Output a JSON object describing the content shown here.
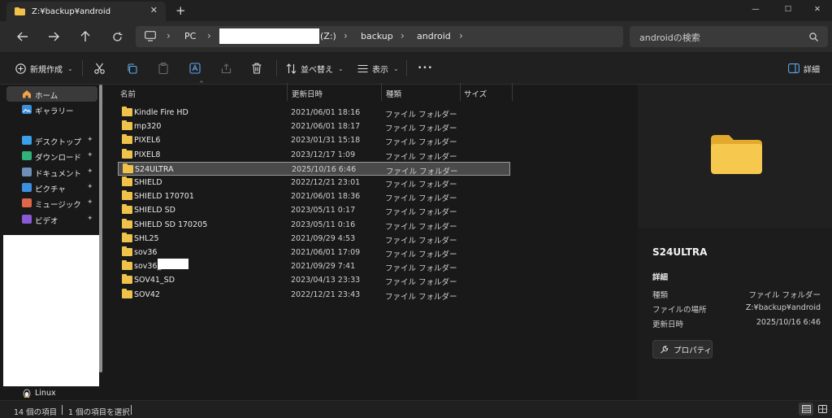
{
  "window": {
    "tab_title": "Z:¥backup¥android",
    "tab_close": "✕",
    "new_tab": "+",
    "minimize": "—",
    "maximize": "☐",
    "close": "✕"
  },
  "address": {
    "pc_icon": "monitor-icon",
    "segments": [
      "PC",
      "(Z:)",
      "backup",
      "android"
    ],
    "search_placeholder": "androidの検索"
  },
  "commands": {
    "new": "新規作成",
    "sort": "並べ替え",
    "view": "表示",
    "more": "•••",
    "details": "詳細"
  },
  "sidebar": {
    "home": "ホーム",
    "gallery": "ギャラリー",
    "quick": [
      {
        "label": "デスクトップ",
        "color": "#3aa0e8"
      },
      {
        "label": "ダウンロード",
        "color": "#2fb37a"
      },
      {
        "label": "ドキュメント",
        "color": "#6f8fb8"
      },
      {
        "label": "ピクチャ",
        "color": "#3d8fe0"
      },
      {
        "label": "ミュージック",
        "color": "#e0664a"
      },
      {
        "label": "ビデオ",
        "color": "#8a5ad6"
      }
    ],
    "linux": "Linux",
    "pin_glyph": "📌"
  },
  "columns": {
    "name": "名前",
    "modified": "更新日時",
    "type": "種類",
    "size": "サイズ"
  },
  "files": [
    {
      "name": "Kindle Fire HD",
      "date": "2021/06/01 18:16",
      "type": "ファイル フォルダー"
    },
    {
      "name": "mp320",
      "date": "2021/06/01 18:17",
      "type": "ファイル フォルダー"
    },
    {
      "name": "PIXEL6",
      "date": "2023/01/31 15:18",
      "type": "ファイル フォルダー"
    },
    {
      "name": "PIXEL8",
      "date": "2023/12/17 1:09",
      "type": "ファイル フォルダー"
    },
    {
      "name": "S24ULTRA",
      "date": "2025/10/16 6:46",
      "type": "ファイル フォルダー",
      "selected": true
    },
    {
      "name": "SHIELD",
      "date": "2022/12/21 23:01",
      "type": "ファイル フォルダー"
    },
    {
      "name": "SHIELD 170701",
      "date": "2021/06/01 18:36",
      "type": "ファイル フォルダー"
    },
    {
      "name": "SHIELD SD",
      "date": "2023/05/11 0:17",
      "type": "ファイル フォルダー"
    },
    {
      "name": "SHIELD SD 170205",
      "date": "2023/05/11 0:16",
      "type": "ファイル フォルダー"
    },
    {
      "name": "SHL25",
      "date": "2021/09/29 4:53",
      "type": "ファイル フォルダー"
    },
    {
      "name": "sov36",
      "date": "2021/06/01 17:09",
      "type": "ファイル フォルダー"
    },
    {
      "name": "sov36_",
      "date": "2021/09/29 7:41",
      "type": "ファイル フォルダー"
    },
    {
      "name": "SOV41_SD",
      "date": "2023/04/13 23:33",
      "type": "ファイル フォルダー"
    },
    {
      "name": "SOV42",
      "date": "2022/12/21 23:43",
      "type": "ファイル フォルダー"
    }
  ],
  "details_pane": {
    "title": "S24ULTRA",
    "section": "詳細",
    "rows": [
      {
        "label": "種類",
        "value": "ファイル フォルダー"
      },
      {
        "label": "ファイルの場所",
        "value": "Z:¥backup¥android"
      },
      {
        "label": "更新日時",
        "value": "2025/10/16 6:46"
      }
    ],
    "properties_button": "プロパティ"
  },
  "status": {
    "count": "14 個の項目",
    "selected": "1 個の項目を選択"
  },
  "colors": {
    "folder": "#f0c24a",
    "background": "#191919",
    "selection": "#4a4a4a"
  }
}
